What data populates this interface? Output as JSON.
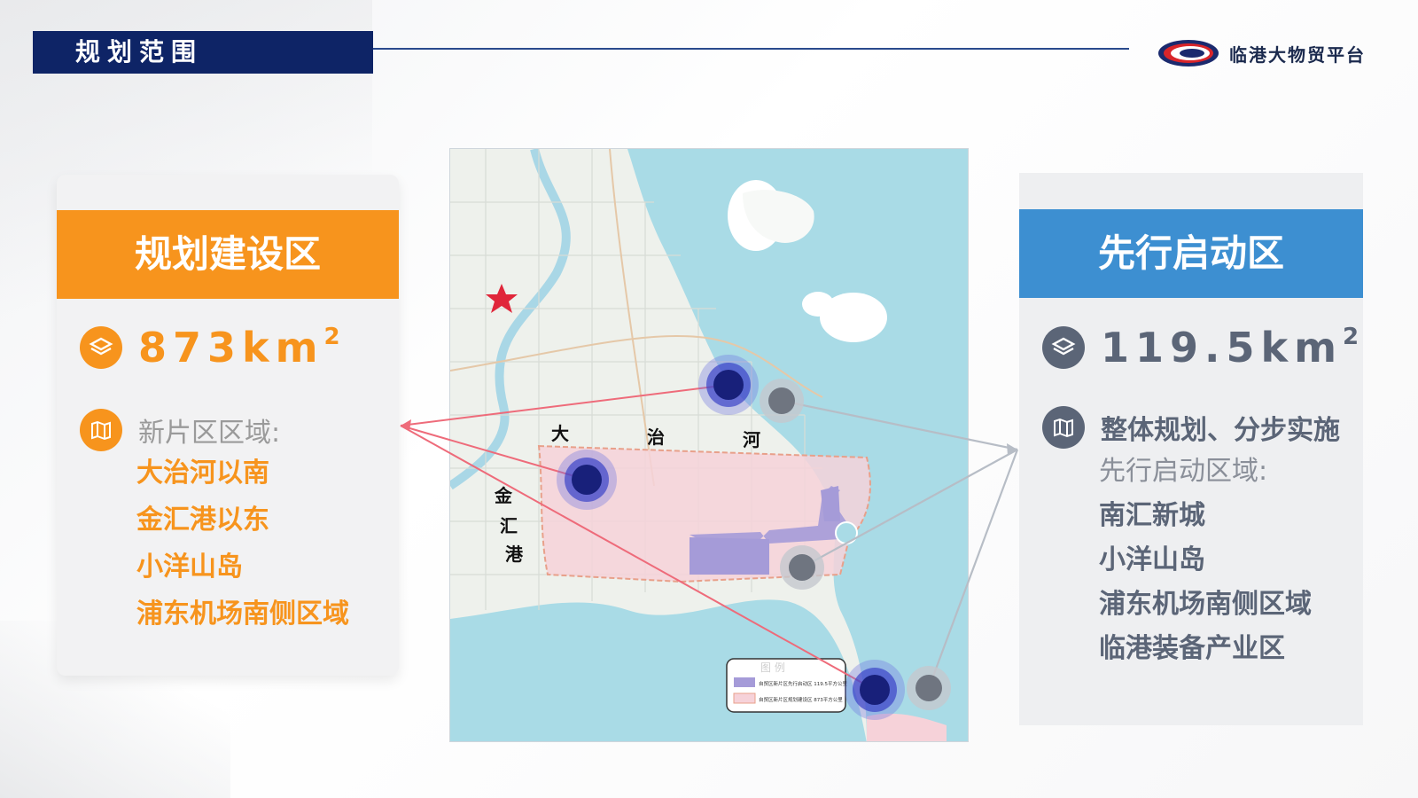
{
  "header": {
    "title": "规划范围",
    "logo_text": "临港大物贸平台"
  },
  "left_card": {
    "banner": "规划建设区",
    "area_value": "873km",
    "area_unit_sup": "2",
    "info_label": "新片区区域:",
    "items": [
      "大治河以南",
      "金汇港以东",
      "小洋山岛",
      "浦东机场南侧区域"
    ],
    "accent_color": "#f7941d"
  },
  "right_card": {
    "banner": "先行启动区",
    "area_value": "119.5km",
    "area_unit_sup": "2",
    "info_label": "整体规划、分步实施",
    "sub_label": "先行启动区域:",
    "items": [
      "南汇新城",
      "小洋山岛",
      "浦东机场南侧区域",
      "临港装备产业区"
    ],
    "accent_color": "#3d8fd1"
  },
  "map": {
    "labels": {
      "dazhi_1": "大",
      "dazhi_2": "治",
      "dazhi_3": "河",
      "jinhui_1": "金",
      "jinhui_2": "汇",
      "jinhui_3": "港",
      "legend_title": "图 例",
      "legend_item_1": "自贸区新片区先行启动区 119.5平方公里",
      "legend_item_2": "自贸区新片区规划建设区 873平方公里"
    }
  }
}
